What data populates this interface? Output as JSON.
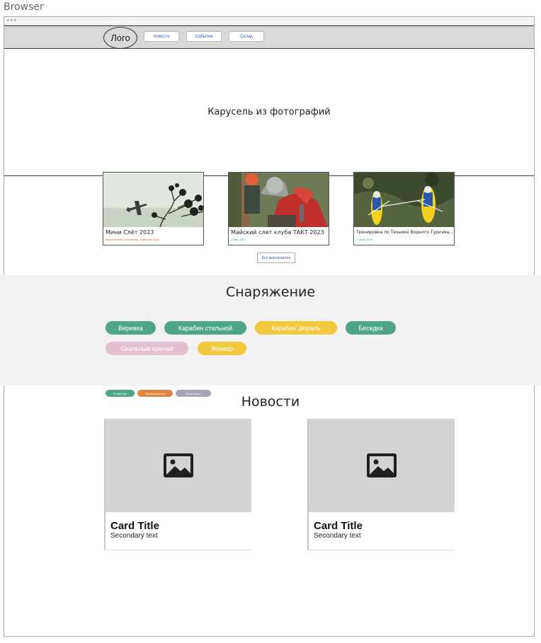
{
  "window": {
    "label": "Browser"
  },
  "nav": {
    "logo": "Лого",
    "links": [
      "Новости",
      "События",
      "Склад"
    ]
  },
  "carousel": {
    "text": "Карусель из фотографий"
  },
  "events": [
    {
      "title": "Мини Слёт 2023",
      "date": "Мероприятие состоялось 3 августа 2023",
      "date_color": "#e0533b"
    },
    {
      "title": "Майский слет клуба ТАКТ 2023",
      "date": "1 мая 2023",
      "date_color": "#2fa37d"
    },
    {
      "title": "Тренировка по Технике Водного Туризма...",
      "date": "1 июля 2023",
      "date_color": "#2fa37d"
    }
  ],
  "all_events_button": "Все мероприятия",
  "equipment": {
    "title": "Снаряжение",
    "items": [
      {
        "label": "Веревка",
        "color": "#4fa58a",
        "status": "available"
      },
      {
        "label": "Карабин стальной",
        "color": "#4fa58a",
        "status": "available"
      },
      {
        "label": "Карабин дюраль",
        "color": "#f1c93e",
        "status": "ending"
      },
      {
        "label": "Беседка",
        "color": "#4fa58a",
        "status": "available"
      },
      {
        "label": "Скальные крючья",
        "color": "#e3c1d1",
        "status": "absent"
      },
      {
        "label": "Жюмар",
        "color": "#f1c93e",
        "status": "ending"
      }
    ],
    "legend": [
      {
        "label": "В наличии",
        "color": "#4fa58a"
      },
      {
        "label": "Заканчивается",
        "color": "#e08444"
      },
      {
        "label": "Отсутствует",
        "color": "#a9a2b4"
      }
    ]
  },
  "news": {
    "title": "Новости",
    "cards": [
      {
        "title": "Card Title",
        "secondary": "Secondary text",
        "icon": "image-placeholder-icon"
      },
      {
        "title": "Card Title",
        "secondary": "Secondary text",
        "icon": "image-placeholder-icon"
      }
    ]
  }
}
